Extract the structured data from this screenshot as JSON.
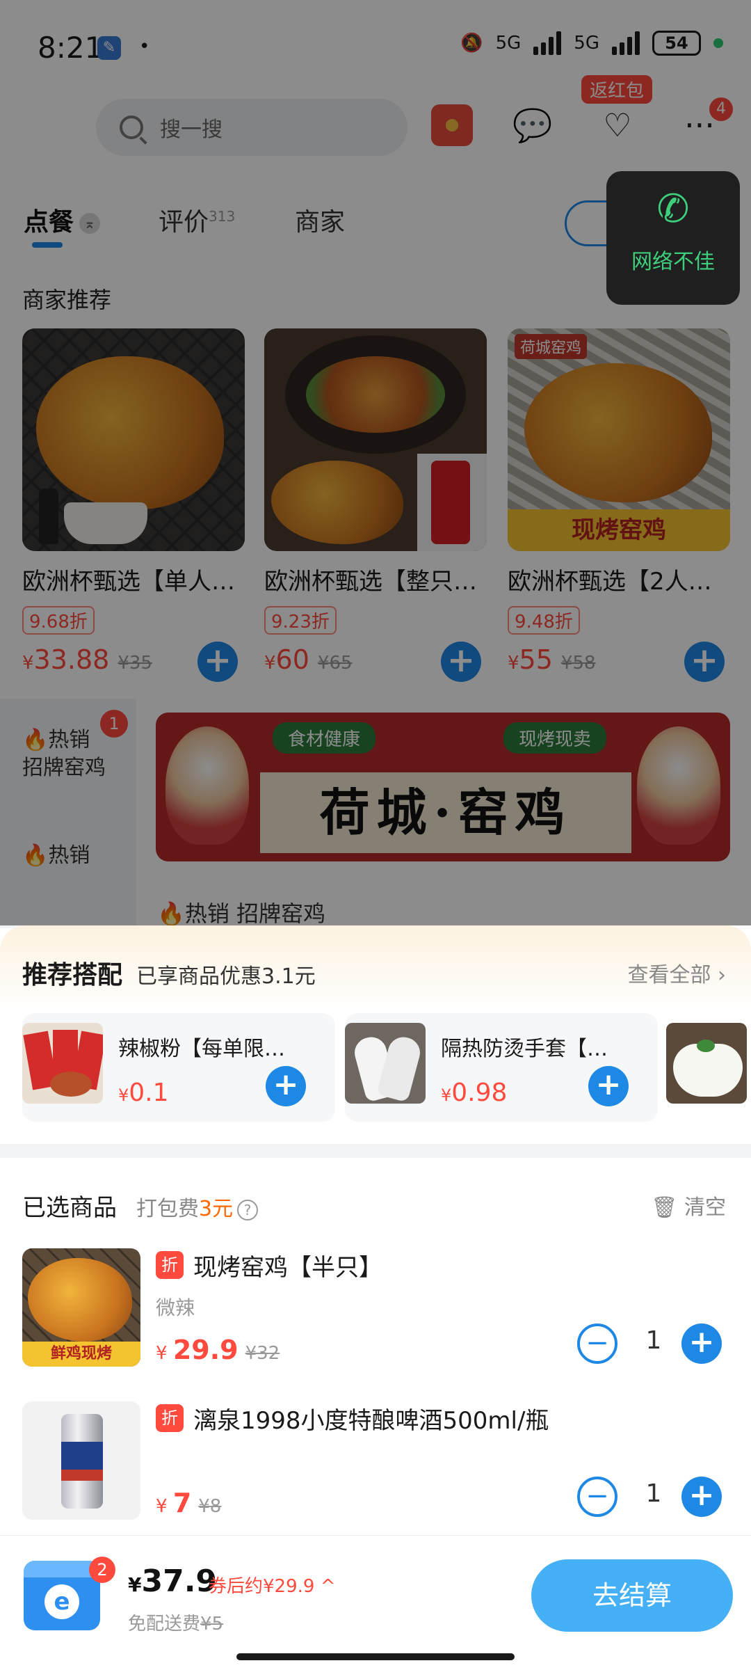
{
  "status": {
    "time": "8:21",
    "net1": "5G",
    "net2": "5G",
    "battery": "54"
  },
  "header": {
    "search_placeholder": "搜一搜",
    "hongbao_label": "返红包",
    "more_badge": "4"
  },
  "tabs": [
    {
      "label": "点餐",
      "count": ""
    },
    {
      "label": "评价",
      "count": "313"
    },
    {
      "label": "商家",
      "count": ""
    }
  ],
  "call_popup": {
    "text": "网络不佳"
  },
  "recommend": {
    "title": "商家推荐",
    "items": [
      {
        "name": "欧洲杯甄选【单人…",
        "discount": "9.68折",
        "price": "33.88",
        "orig": "¥35"
      },
      {
        "name": "欧洲杯甄选【整只…",
        "discount": "9.23折",
        "price": "60",
        "orig": "¥65"
      },
      {
        "name": "欧洲杯甄选【2人…",
        "discount": "9.48折",
        "price": "55",
        "orig": "¥58"
      }
    ],
    "img3_caption": "现烤窑鸡",
    "img3_corner": "荷城窑鸡"
  },
  "leftnav": {
    "items": [
      "🔥热销",
      "招牌窑鸡",
      "热销"
    ],
    "badge": "1"
  },
  "banner": {
    "tag_left": "食材健康",
    "tag_right": "现烤现卖",
    "title": "荷城·窑鸡"
  },
  "category_heading": "🔥热销 招牌窑鸡",
  "combo": {
    "title": "推荐搭配",
    "subtitle": "已享商品优惠3.1元",
    "view_all": "查看全部 ›",
    "items": [
      {
        "name": "辣椒粉【每单限…",
        "price": "0.1"
      },
      {
        "name": "隔热防烫手套【…",
        "price": "0.98"
      }
    ]
  },
  "selected": {
    "title": "已选商品",
    "fee_label": "打包费",
    "fee_value": "3元",
    "clear_label": "清空",
    "items": [
      {
        "name": "现烤窑鸡【半只】",
        "spec": "微辣",
        "price": "29.9",
        "orig": "¥32",
        "qty": "1",
        "img_caption": "鲜鸡现烤"
      },
      {
        "name": "漓泉1998小度特酿啤酒500ml/瓶",
        "spec": "",
        "price": "7",
        "orig": "¥8",
        "qty": "1"
      }
    ]
  },
  "checkout": {
    "cart_count": "2",
    "total": "37.9",
    "after_coupon": "券后约¥29.9 ^",
    "delivery_label": "免配送费",
    "delivery_orig": "¥5",
    "button": "去结算"
  },
  "colors": {
    "accent": "#1e88e5",
    "price": "#ff4a3d",
    "call_green": "#3ecf7c"
  }
}
